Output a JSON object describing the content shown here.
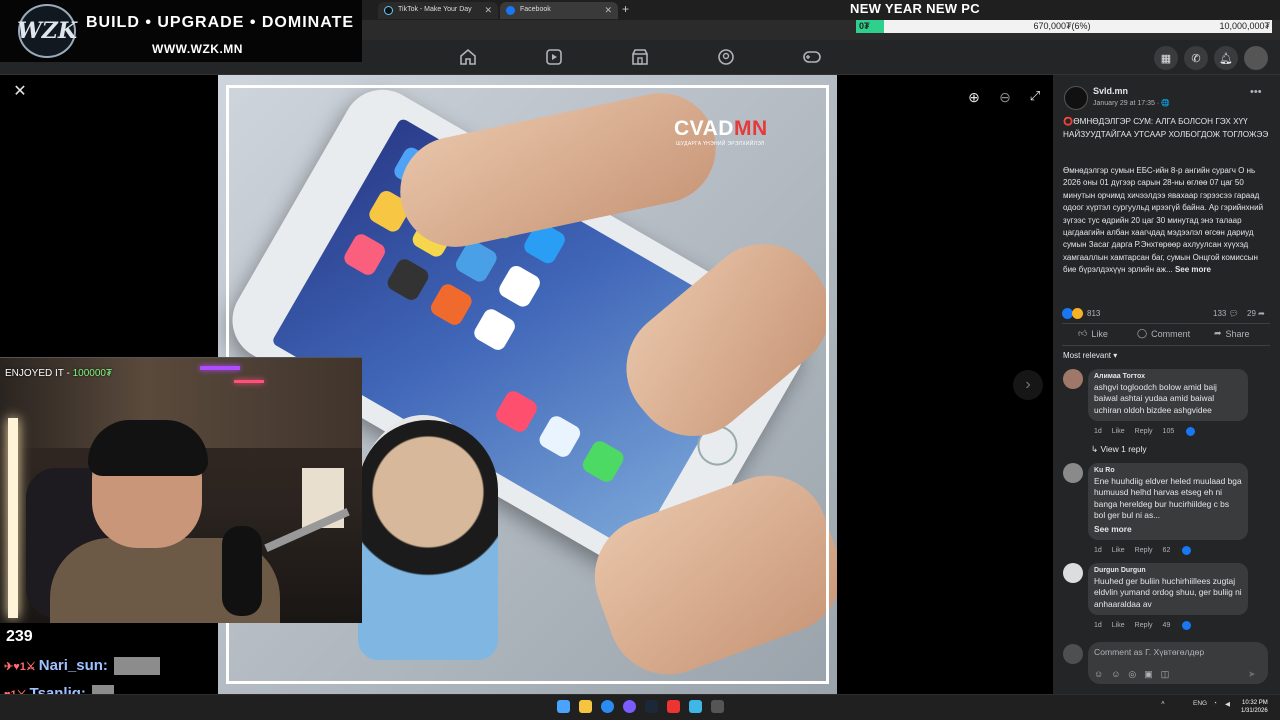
{
  "stream_banner": {
    "logo": "WZK",
    "tagline": "BUILD • UPGRADE • DOMINATE",
    "url": "WWW.WZK.MN"
  },
  "goal": {
    "title": "NEW YEAR NEW PC",
    "start": "0₮",
    "current": "670,000₮(6%)",
    "target": "10,000,000₮",
    "progress_fraction": 0.067,
    "fill_color": "#2fd08c"
  },
  "browser": {
    "tabs": [
      {
        "title": "TikTok - Make Your Day",
        "icon": "tiktok-icon"
      },
      {
        "title": "Facebook",
        "icon": "facebook-icon"
      }
    ],
    "new_tab_glyph": "+"
  },
  "facebook_nav": {
    "items": [
      "home-icon",
      "video-icon",
      "marketplace-icon",
      "groups-icon",
      "gaming-icon"
    ],
    "right_icons": [
      "menu-grid-icon",
      "messenger-icon",
      "notifications-icon",
      "profile-avatar"
    ]
  },
  "viewer": {
    "close_glyph": "✕",
    "zoom_in_glyph": "⊕",
    "zoom_out_glyph": "⊖",
    "fullscreen_glyph": "⤢",
    "next_glyph": "›",
    "watermark_main_a": "CVAD",
    "watermark_main_b": "MN",
    "watermark_sub": "ШУДАРГА ҮНЭНИЙ ЭРЭЛХИЙЛЭЛ"
  },
  "stream": {
    "alert_prefix": "ENJOYED IT - ",
    "alert_amount": "100000₮",
    "viewer_count": "239",
    "chat": [
      {
        "user": "Nari_sun:",
        "emotes": "✈♥1⚔"
      },
      {
        "user": "Tsanlig:",
        "emotes": "♥1⚔"
      }
    ]
  },
  "post": {
    "page_name": "Svld.mn",
    "date": "January 29 at 17:35 · 🌐",
    "more_glyph": "•••",
    "title": "⭕ӨМНӨДЭЛГЭР СУМ: АЛГА БОЛСОН ГЭХ ХҮҮ НАЙЗУУДТАЙГАА УТСААР ХОЛБОГДОЖ ТОГЛОЖЭЭ",
    "body": "Өмнөдэлгэр сумын ЕБС-ийн 8-р ангийн сурагч О нь 2026 оны 01 дүгээр сарын 28-ны өглөө 07 цаг 50 минутын орчимд хичээлдээ явахаар гэрээсээ гараад одоог хүртэл сургуульд ирээгүй байна. Ар гэрийнхний зүгээс тус өдрийн 20 цаг 30 минутад энэ талаар цагдаагийн албан хаагчдад мэдээлэл өгсөн дариуд сумын Засаг дарга Р.Энхтөрөөр ахлуулсан хүүхэд хамгааллын хамтарсан баг, сумын Онцгой комиссын бие бүрэлдэхүүн эрлийн аж...",
    "see_more": "See more",
    "reactions": "813",
    "comments_count": "133",
    "shares_count": "29",
    "actions": {
      "like": "Like",
      "comment": "Comment",
      "share": "Share"
    },
    "sort_label": "Most relevant"
  },
  "comments": [
    {
      "name": "Алимаа Тогтох",
      "text": "ashgvi togloodch bolow amid baij baiwal ashtai yudaa amid baiwal uchiran oldoh bizdee ashgvidee",
      "time": "1d",
      "like": "Like",
      "reply": "Reply",
      "likes": "105"
    },
    {
      "name": "Ku Ro",
      "text": "Ene huuhdiig eldver heled muulaad bga humuusd helhd harvas etseg eh ni banga hereldeg bur hucirhiildeg c bs bol ger bul ni as...",
      "see_more": "See more",
      "time": "1d",
      "like": "Like",
      "reply": "Reply",
      "likes": "62"
    },
    {
      "name": "Durgun Durgun",
      "text": "Huuhed ger buliin huchirhiillees zugtaj eldvlin yumand ordog shuu, ger buliig ni anhaaraldaa av",
      "time": "1d",
      "like": "Like",
      "reply": "Reply",
      "likes": "49"
    }
  ],
  "view_replies": "View 1 reply",
  "composer": {
    "placeholder": "Comment as Г. Хүвтөгөлдөр",
    "tools": "☺☺◎▣◫"
  },
  "taskbar": {
    "lang": "ENG",
    "time": "10:32 PM",
    "date": "1/31/2026"
  }
}
